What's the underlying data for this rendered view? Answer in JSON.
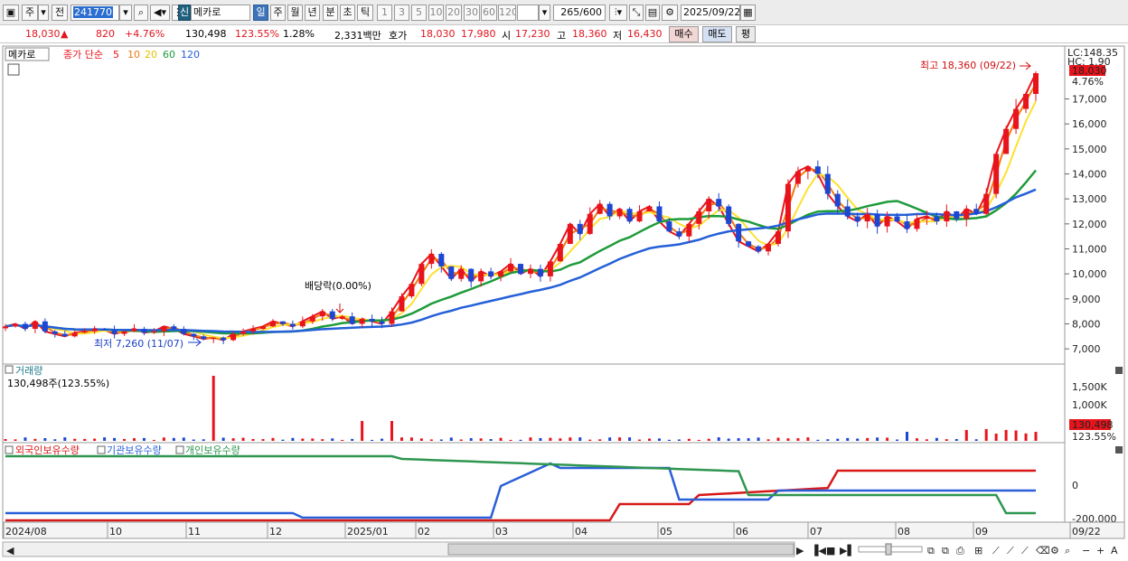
{
  "toolbar": {
    "period_mode": "주",
    "prev_label": "전",
    "stock_code": "241770",
    "new_badge": "신",
    "stock_name": "메카로",
    "timeframes": [
      "일",
      "주",
      "월",
      "년",
      "분",
      "초",
      "틱"
    ],
    "active_timeframe": "일",
    "intervals": [
      "1",
      "3",
      "5",
      "10",
      "20",
      "30",
      "60",
      "120"
    ],
    "count_value": "265",
    "count_total": "/600",
    "date": "2025/09/22"
  },
  "quote": {
    "price": "18,030",
    "change": "820",
    "change_pct": "+4.76%",
    "volume": "130,498",
    "volume_ratio": "123.55%",
    "turnover": "1.28%",
    "amount": "2,331백만",
    "hoga_label": "호가",
    "hoga_ask": "18,030",
    "hoga_bid": "17,980",
    "open_label": "시",
    "open": "17,230",
    "high_label": "고",
    "high": "18,360",
    "low_label": "저",
    "low": "16,430",
    "buy_button": "매수",
    "sell_button": "매도",
    "eval_button": "평"
  },
  "price_panel": {
    "title": "메카로",
    "ma_legend_prefix": "종가 단순",
    "ma_periods": [
      "5",
      "10",
      "20",
      "60",
      "120"
    ],
    "ma_colors": [
      "#e8141c",
      "#f07a10",
      "#ffe030",
      "#1e9b3a",
      "#2460d8"
    ],
    "high_annotation": "최고 18,360 (09/22)",
    "low_annotation": "최저 7,260 (11/07)",
    "dividend_annotation": "배당락(0.00%)",
    "last_price_tag": "18,030",
    "last_pct_tag": "4.76%",
    "lc_label": "LC:148.35",
    "hc_label": "HC: 1.90",
    "y_ticks": [
      "17,000",
      "16,000",
      "15,000",
      "14,000",
      "13,000",
      "12,000",
      "11,000",
      "10,000",
      "9,000",
      "8,000",
      "7,000"
    ]
  },
  "volume_panel": {
    "title": "거래량",
    "value_label": "130,498주(123.55%)",
    "y_ticks": [
      "1,500K",
      "1,000K"
    ],
    "last_volume_tag": "130,498",
    "last_ratio_tag": "123.55%"
  },
  "holdings_panel": {
    "legend": [
      "외국인보유수량",
      "기관보유수량",
      "개인보유수량"
    ],
    "legend_colors": [
      "#d81818",
      "#2a5fd8",
      "#2e9650"
    ],
    "y_ticks": [
      "0",
      "-200,000"
    ]
  },
  "x_axis": {
    "labels": [
      "2024/08",
      "10",
      "11",
      "12",
      "2025/01",
      "02",
      "03",
      "04",
      "05",
      "06",
      "07",
      "08",
      "09",
      "09/22"
    ]
  },
  "chart_data": {
    "type": "candlestick",
    "candle_up_color": "#e8141c",
    "candle_down_color": "#1c46d4",
    "price_ylim": [
      6500,
      18500
    ],
    "closes": [
      7900,
      8000,
      7800,
      8100,
      7700,
      7600,
      7500,
      7650,
      7700,
      7800,
      7750,
      7600,
      7700,
      7800,
      7650,
      7700,
      7900,
      7800,
      7600,
      7500,
      7400,
      7450,
      7350,
      7600,
      7700,
      7800,
      7900,
      8100,
      8000,
      7900,
      8100,
      8300,
      8500,
      8200,
      8300,
      8000,
      8200,
      8100,
      8000,
      8500,
      9100,
      9600,
      10400,
      10800,
      10300,
      9800,
      10200,
      9700,
      10100,
      9900,
      10100,
      10400,
      10000,
      10200,
      9900,
      10500,
      11200,
      12000,
      11600,
      12400,
      12800,
      12300,
      12600,
      12100,
      12500,
      12700,
      12100,
      11700,
      11500,
      12000,
      12500,
      13000,
      12700,
      12000,
      11300,
      11100,
      10900,
      11200,
      11700,
      13600,
      14100,
      14300,
      14000,
      13200,
      12700,
      12300,
      12100,
      12400,
      11900,
      12300,
      12100,
      11800,
      12200,
      12300,
      12100,
      12500,
      12200,
      12600,
      12400,
      13200,
      14800,
      15800,
      16600,
      17200,
      18030
    ]
  }
}
